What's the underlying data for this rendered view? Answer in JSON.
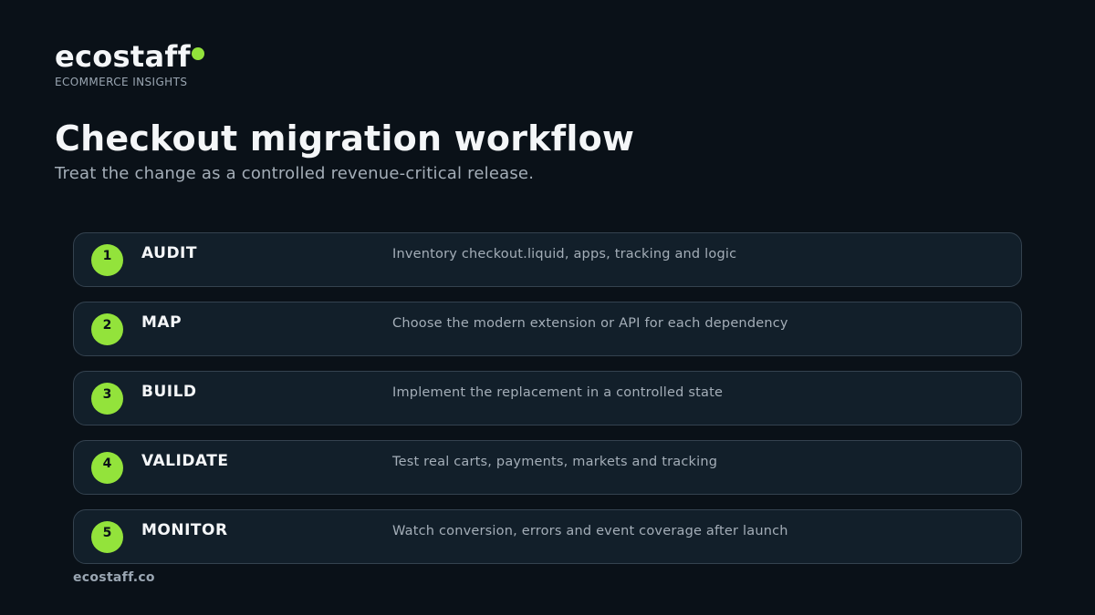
{
  "brand": {
    "name": "ecostaff",
    "tagline": "ECOMMERCE INSIGHTS",
    "accent_color": "#93e33b"
  },
  "page": {
    "title": "Checkout migration workflow",
    "subtitle": "Treat the change as a controlled revenue-critical release."
  },
  "steps": [
    {
      "number": "1",
      "title": "AUDIT",
      "description": "Inventory checkout.liquid, apps, tracking and logic"
    },
    {
      "number": "2",
      "title": "MAP",
      "description": "Choose the modern extension or API for each dependency"
    },
    {
      "number": "3",
      "title": "BUILD",
      "description": "Implement the replacement in a controlled state"
    },
    {
      "number": "4",
      "title": "VALIDATE",
      "description": "Test real carts, payments, markets and tracking"
    },
    {
      "number": "5",
      "title": "MONITOR",
      "description": "Watch conversion, errors and event coverage after launch"
    }
  ],
  "footer": {
    "url": "ecostaff.co"
  }
}
